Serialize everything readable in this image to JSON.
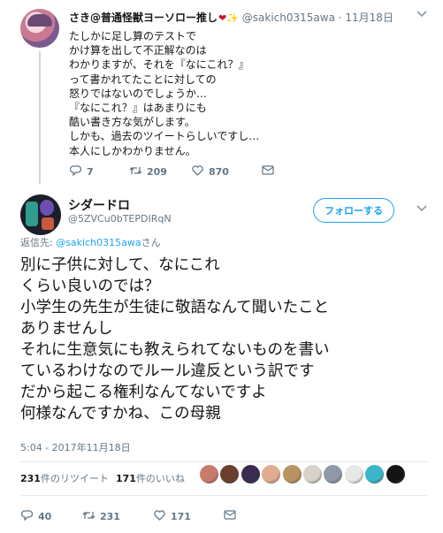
{
  "reply_tweet": {
    "name": "さき@普通怪獣ヨーソロー推し",
    "emoji_heart": "❤",
    "emoji_sparkle": "✨",
    "handle": "@sakich0315awa",
    "separator": "·",
    "time": "11月18日",
    "lines": [
      "たしかに足し算のテストで",
      "かけ算を出して不正解なのは",
      "わかりますが、それを『なにこれ？』",
      "って書かれてたことに対しての",
      "怒りではないのでしょうか…",
      "『なにこれ？』はあまりにも",
      "酷い書き方な気がします。",
      "しかも、過去のツイートらしいですし…",
      "本人にしかわかりません。"
    ],
    "actions": {
      "reply_count": "7",
      "retweet_count": "209",
      "like_count": "870"
    }
  },
  "main_tweet": {
    "display_name": "シダードロ",
    "handle": "@5ZVCu0bTEPDIRqN",
    "follow_label": "フォローする",
    "replying_prefix": "返信先: ",
    "replying_to": "@sakich0315awa",
    "replying_suffix": "さん",
    "lines": [
      "別に子供に対して、なにこれ",
      "くらい良いのでは？",
      "小学生の先生が生徒に敬語なんて聞いたこと",
      "ありませんし",
      "それに生意気にも教えられてないものを書い",
      "ているわけなのでルール違反という訳です",
      "だから起こる権利なんてないですよ",
      "何様なんですかね、この母親"
    ],
    "timestamp": "5:04 - 2017年11月18日",
    "stats": {
      "retweets_num": "231",
      "retweets_label": "件のリツイート",
      "likes_num": "171",
      "likes_label": "件のいいね"
    },
    "likers": [
      "#c97b6a",
      "#6b3f2c",
      "#3a2b4f",
      "#e0ac8f",
      "#b8935f",
      "#d9d2c7",
      "#8e9aa8",
      "#e8e8e8",
      "#3ab5c9",
      "#141414"
    ],
    "actions": {
      "reply_count": "40",
      "retweet_count": "231",
      "like_count": "171"
    }
  },
  "colors": {
    "accent": "#1da1f2",
    "muted": "#657786",
    "border": "#e6ecf0"
  }
}
